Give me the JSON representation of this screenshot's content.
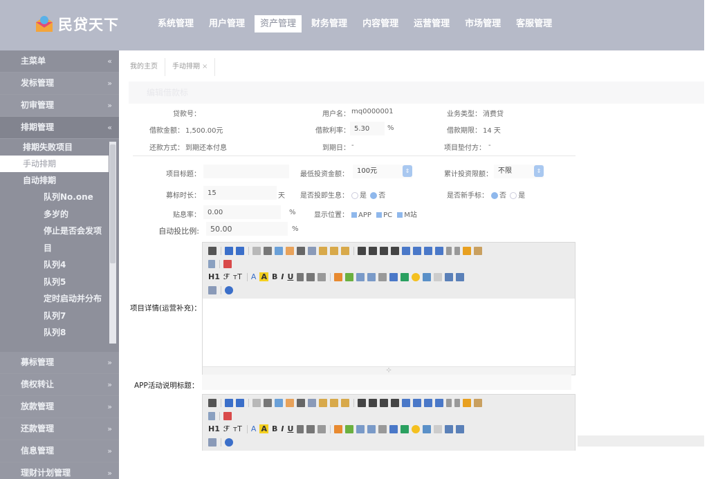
{
  "brand": {
    "name": "民贷天下"
  },
  "topnav": [
    {
      "label": "系统管理",
      "active": false
    },
    {
      "label": "用户管理",
      "active": false
    },
    {
      "label": "资产管理",
      "active": true
    },
    {
      "label": "财务管理",
      "active": false
    },
    {
      "label": "内容管理",
      "active": false
    },
    {
      "label": "运营管理",
      "active": false
    },
    {
      "label": "市场管理",
      "active": false
    },
    {
      "label": "客服管理",
      "active": false
    }
  ],
  "sidebar": {
    "main": "主菜单",
    "collapse_icon": "«",
    "groups": [
      "发标管理",
      "初审管理",
      "排期管理",
      "募标管理",
      "债权转让",
      "放款管理",
      "还款管理",
      "信息管理",
      "理财计划管理"
    ],
    "schedule_subs": [
      "排期失败项目",
      "手动排期",
      "自动排期"
    ],
    "auto_subs": [
      "队列No.one",
      "多岁的",
      "停止是否会发项",
      "目",
      "队列4",
      "队列5",
      "定时启动并分布",
      "队列7",
      "队列8"
    ]
  },
  "tabs": [
    {
      "label": "我的主页"
    },
    {
      "label": "手动排期",
      "close": "×"
    }
  ],
  "form": {
    "title": "编辑借款标",
    "loan_no_label": "贷款号：",
    "username_label": "用户名：",
    "username_value": "mq0000001",
    "biz_type_label": "业务类型：",
    "biz_type_value": "消费贷",
    "amount_label": "借款金额：",
    "amount_value": "1,500.00元",
    "rate_label": "借款利率：",
    "rate_value": "5.30",
    "rate_unit": "%",
    "term_label": "借款期限：",
    "term_value": "14 天",
    "repay_label": "还款方式：",
    "repay_value": "到期还本付息",
    "due_label": "到期日：",
    "due_value": "-",
    "prepay_label": "项目垫付方：",
    "prepay_value": "-",
    "project_title_label": "项目标题：",
    "min_invest_label": "最低投资金额：",
    "min_invest_value": "100元",
    "cum_invest_label": "累计投资限额：",
    "cum_invest_value": "不限",
    "raise_days_label": "募标时长：",
    "raise_days_value": "15",
    "raise_days_unit": "天",
    "interest_label": "是否投即生息：",
    "interest_yes": "是",
    "interest_no": "否",
    "newbie_label": "是否新手标：",
    "newbie_no": "否",
    "newbie_yes": "是",
    "subsidy_label": "贴息率：",
    "subsidy_value": "0.00",
    "subsidy_unit": "%",
    "display_label": "显示位置：",
    "display_app": "APP",
    "display_pc": "PC",
    "display_m": "M站",
    "auto_ratio_label": "自动投比例:",
    "auto_ratio_value": "50.00",
    "auto_ratio_unit": "%",
    "detail_label": "项目详情(运营补充)：",
    "app_title_label": "APP活动说明标题："
  },
  "editor": {
    "h1": "H1",
    "font": "ℱ",
    "size": "тT",
    "color_a": "A",
    "bold": "B",
    "italic": "I",
    "underline": "U"
  },
  "colors": {
    "header": "#b6bac8",
    "sidebar": "#8e909b",
    "accent": "#8fb8ec"
  }
}
